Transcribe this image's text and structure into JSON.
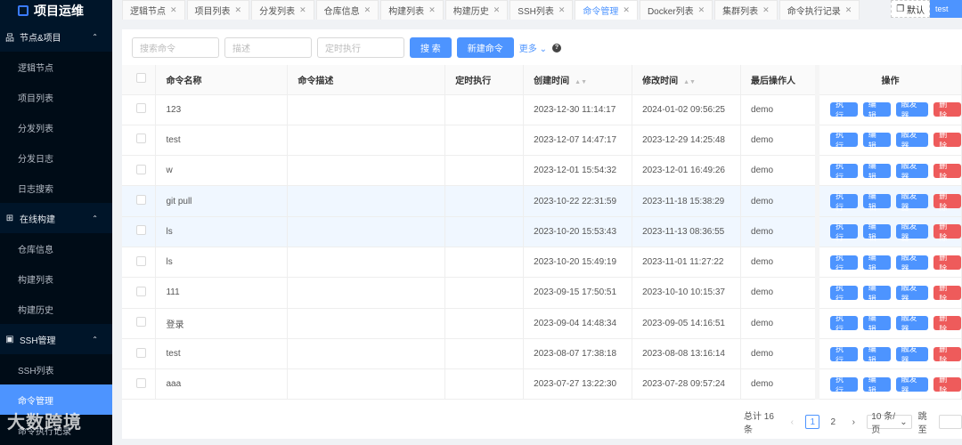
{
  "app": {
    "title": "项目运维"
  },
  "sidebar": {
    "groups": [
      {
        "label": "节点&项目",
        "icon": "sitemap-icon",
        "items": [
          "逻辑节点",
          "项目列表",
          "分发列表",
          "分发日志",
          "日志搜索"
        ]
      },
      {
        "label": "在线构建",
        "icon": "build-icon",
        "items": [
          "仓库信息",
          "构建列表",
          "构建历史"
        ]
      },
      {
        "label": "SSH管理",
        "icon": "terminal-icon",
        "items": [
          "SSH列表",
          "命令管理",
          "命令执行记录"
        ]
      }
    ],
    "active": "命令管理"
  },
  "watermark": "大数跨境",
  "tabs": [
    "逻辑节点",
    "项目列表",
    "分发列表",
    "仓库信息",
    "构建列表",
    "构建历史",
    "SSH列表",
    "命令管理",
    "Docker列表",
    "集群列表",
    "命令执行记录"
  ],
  "active_tab": "命令管理",
  "workspace": {
    "label": "默认",
    "user": "test"
  },
  "toolbar": {
    "search_placeholder": "搜索命令",
    "desc_placeholder": "描述",
    "cron_placeholder": "定时执行",
    "search": "搜 索",
    "new": "新建命令",
    "more": "更多"
  },
  "table": {
    "headers": [
      "命令名称",
      "命令描述",
      "定时执行",
      "创建时间",
      "修改时间",
      "最后操作人",
      "操作"
    ],
    "actions": [
      "执 行",
      "编 辑",
      "触发器",
      "删 除"
    ],
    "rows": [
      {
        "name": "123",
        "created": "2023-12-30 11:14:17",
        "modified": "2024-01-02 09:56:25",
        "user": "demo"
      },
      {
        "name": "test",
        "created": "2023-12-07 14:47:17",
        "modified": "2023-12-29 14:25:48",
        "user": "demo"
      },
      {
        "name": "w",
        "created": "2023-12-01 15:54:32",
        "modified": "2023-12-01 16:49:26",
        "user": "demo"
      },
      {
        "name": "git pull",
        "created": "2023-10-22 22:31:59",
        "modified": "2023-11-18 15:38:29",
        "user": "demo"
      },
      {
        "name": "ls",
        "created": "2023-10-20 15:53:43",
        "modified": "2023-11-13 08:36:55",
        "user": "demo"
      },
      {
        "name": "ls",
        "created": "2023-10-20 15:49:19",
        "modified": "2023-11-01 11:27:22",
        "user": "demo"
      },
      {
        "name": "111",
        "created": "2023-09-15 17:50:51",
        "modified": "2023-10-10 10:15:37",
        "user": "demo"
      },
      {
        "name": "登录",
        "created": "2023-09-04 14:48:34",
        "modified": "2023-09-05 14:16:51",
        "user": "demo"
      },
      {
        "name": "test",
        "created": "2023-08-07 17:38:18",
        "modified": "2023-08-08 13:16:14",
        "user": "demo"
      },
      {
        "name": "aaa",
        "created": "2023-07-27 13:22:30",
        "modified": "2023-07-28 09:57:24",
        "user": "demo"
      }
    ]
  },
  "pagination": {
    "total": "总计 16 条",
    "pages": [
      "1",
      "2"
    ],
    "current": "1",
    "page_size": "10 条/页",
    "jump": "跳至"
  }
}
